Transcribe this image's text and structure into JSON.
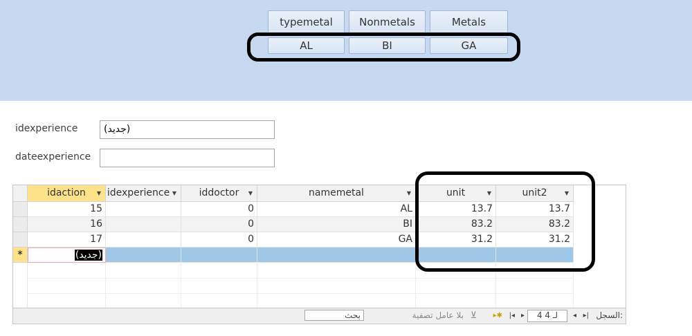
{
  "tabs_row1": [
    "typemetal",
    "Nonmetals",
    "Metals"
  ],
  "tabs_row2": [
    "AL",
    "BI",
    "GA"
  ],
  "form": {
    "idexperience_label": "idexperience",
    "idexperience_value": "(جديد)",
    "dateexperience_label": "dateexperience",
    "dateexperience_value": ""
  },
  "table": {
    "columns": [
      "idaction",
      "idexperience",
      "iddoctor",
      "namemetal",
      "unit",
      "unit2"
    ],
    "rows": [
      [
        "15",
        "",
        "0",
        "AL",
        "13.7",
        "13.7"
      ],
      [
        "16",
        "",
        "0",
        "BI",
        "83.2",
        "83.2"
      ],
      [
        "17",
        "",
        "0",
        "GA",
        "31.2",
        "31.2"
      ]
    ],
    "new_row_label": "(جديد)",
    "new_row_marker": "*"
  },
  "status": {
    "record_label": "السجل:",
    "record_value": "4 لـ 4",
    "filter_label": "بلا عامل تصفية",
    "search_placeholder": "بحث"
  },
  "colors": {
    "header_bg": "#c6d9f0",
    "selected_header": "#ffe38a",
    "new_row": "#9fc7e8"
  }
}
